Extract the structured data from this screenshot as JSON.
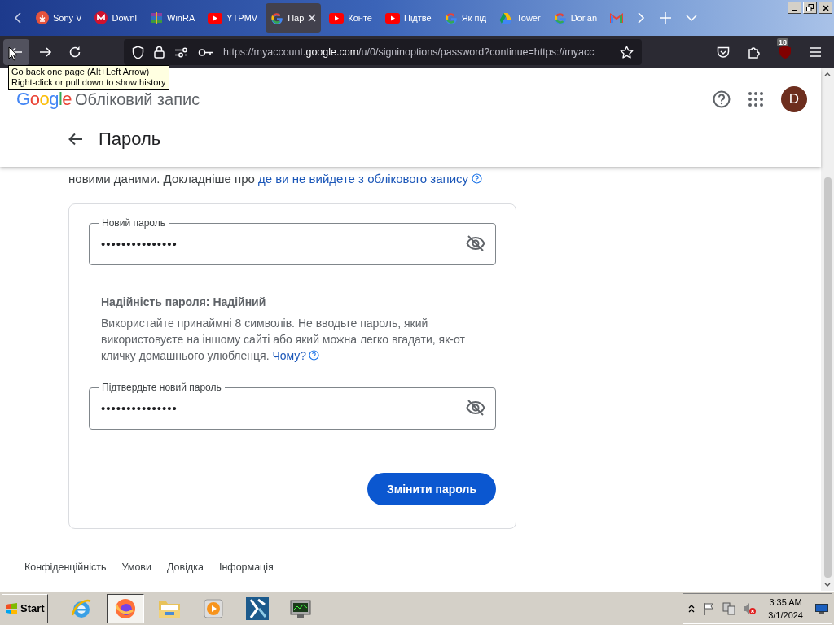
{
  "tabs": [
    {
      "kind": "download",
      "label": "Sony V",
      "selected": false
    },
    {
      "kind": "mail",
      "label": "Downl",
      "selected": false
    },
    {
      "kind": "archive",
      "label": "WinRA",
      "selected": false
    },
    {
      "kind": "video",
      "label": "YTPMV",
      "selected": false
    },
    {
      "kind": "google",
      "label": "Пар",
      "selected": true
    },
    {
      "kind": "video",
      "label": "Конте",
      "selected": false
    },
    {
      "kind": "video",
      "label": "Підтве",
      "selected": false
    },
    {
      "kind": "google",
      "label": "Як під",
      "selected": false
    },
    {
      "kind": "drive",
      "label": "Tower",
      "selected": false
    },
    {
      "kind": "google",
      "label": "Dorian",
      "selected": false
    },
    {
      "kind": "gmail",
      "selected": false
    }
  ],
  "toolbar": {
    "url": "https://myaccount.**google.com**/u/0/signinoptions/password?continue=https://myacc",
    "badge": "18"
  },
  "tooltip": {
    "lines": [
      "Go back one page (Alt+Left Arrow)",
      "Right-click or pull down to show history"
    ]
  },
  "header": {
    "logo": "Google",
    "product": "Обліковий запис",
    "avatar": "D",
    "page_title": "Пароль"
  },
  "intro": {
    "text": "новими даними. Докладніше про ",
    "link": "де ви не вийдете з облікового запису"
  },
  "form": {
    "new_password": {
      "label": "Новий пароль",
      "value": "•••••••••••••••"
    },
    "strength": "Надійність пароля: Надійний",
    "hint": "Використайте принаймні 8 символів. Не вводьте пароль, який використовуєте на іншому сайті або який можна легко вгадати, як-от кличку домашнього улюбленця. ",
    "hint_link": "Чому?",
    "confirm_password": {
      "label": "Підтвердьте новий пароль",
      "value": "•••••••••••••••"
    },
    "submit": "Змінити пароль"
  },
  "footer": [
    "Конфіденційність",
    "Умови",
    "Довідка",
    "Інформація"
  ],
  "taskbar": {
    "start": "Start",
    "apps": [
      {
        "kind": "ie",
        "selected": false
      },
      {
        "kind": "firefox",
        "selected": true
      },
      {
        "kind": "folder",
        "selected": false
      },
      {
        "kind": "player",
        "selected": false
      },
      {
        "kind": "editor",
        "selected": false
      },
      {
        "kind": "monitor",
        "selected": false
      }
    ],
    "time": "3:35 AM",
    "date": "3/1/2024"
  }
}
